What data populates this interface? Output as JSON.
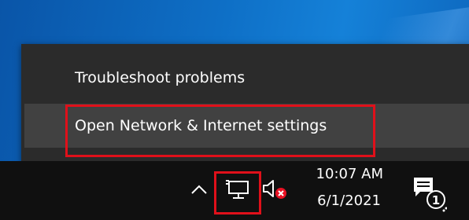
{
  "context_menu": {
    "items": [
      {
        "label": "Troubleshoot problems"
      },
      {
        "label": "Open Network & Internet settings"
      }
    ]
  },
  "taskbar": {
    "clock": {
      "time": "10:07 AM",
      "date": "6/1/2021"
    },
    "notifications": {
      "count": "1"
    },
    "tray_icons": [
      "chevron-up-icon",
      "network-icon",
      "volume-muted-icon",
      "action-center-icon"
    ]
  },
  "colors": {
    "menu_bg": "#2b2b2b",
    "menu_hover": "#414141",
    "highlight": "#e0101a",
    "taskbar": "#101010"
  }
}
